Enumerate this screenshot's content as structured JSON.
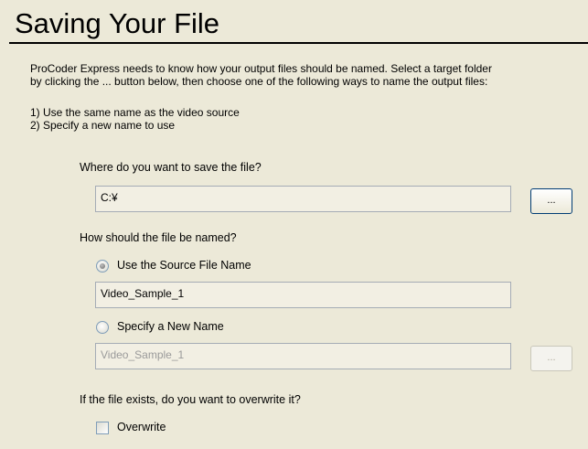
{
  "header": {
    "title": "Saving Your File"
  },
  "intro": {
    "line1": "ProCoder Express needs to know how your output files should be named.  Select a target folder",
    "line2": "by clicking the ... button below, then choose one of the following ways to name the output files:"
  },
  "options_list": [
    "1) Use the same name as the video source",
    "2) Specify a new name to use"
  ],
  "save_location": {
    "question": "Where do you want to save the file?",
    "path_value": "C:¥",
    "browse_label": "..."
  },
  "naming": {
    "question": "How should the file be named?",
    "source_option_label": "Use the Source File Name",
    "source_option_selected": true,
    "source_name_value": "Video_Sample_1",
    "new_option_label": "Specify a New Name",
    "new_option_selected": false,
    "new_name_value": "Video_Sample_1",
    "new_browse_label": "..."
  },
  "overwrite": {
    "question": "If the file exists, do you want to overwrite it?",
    "checkbox_label": "Overwrite",
    "checked": false
  }
}
